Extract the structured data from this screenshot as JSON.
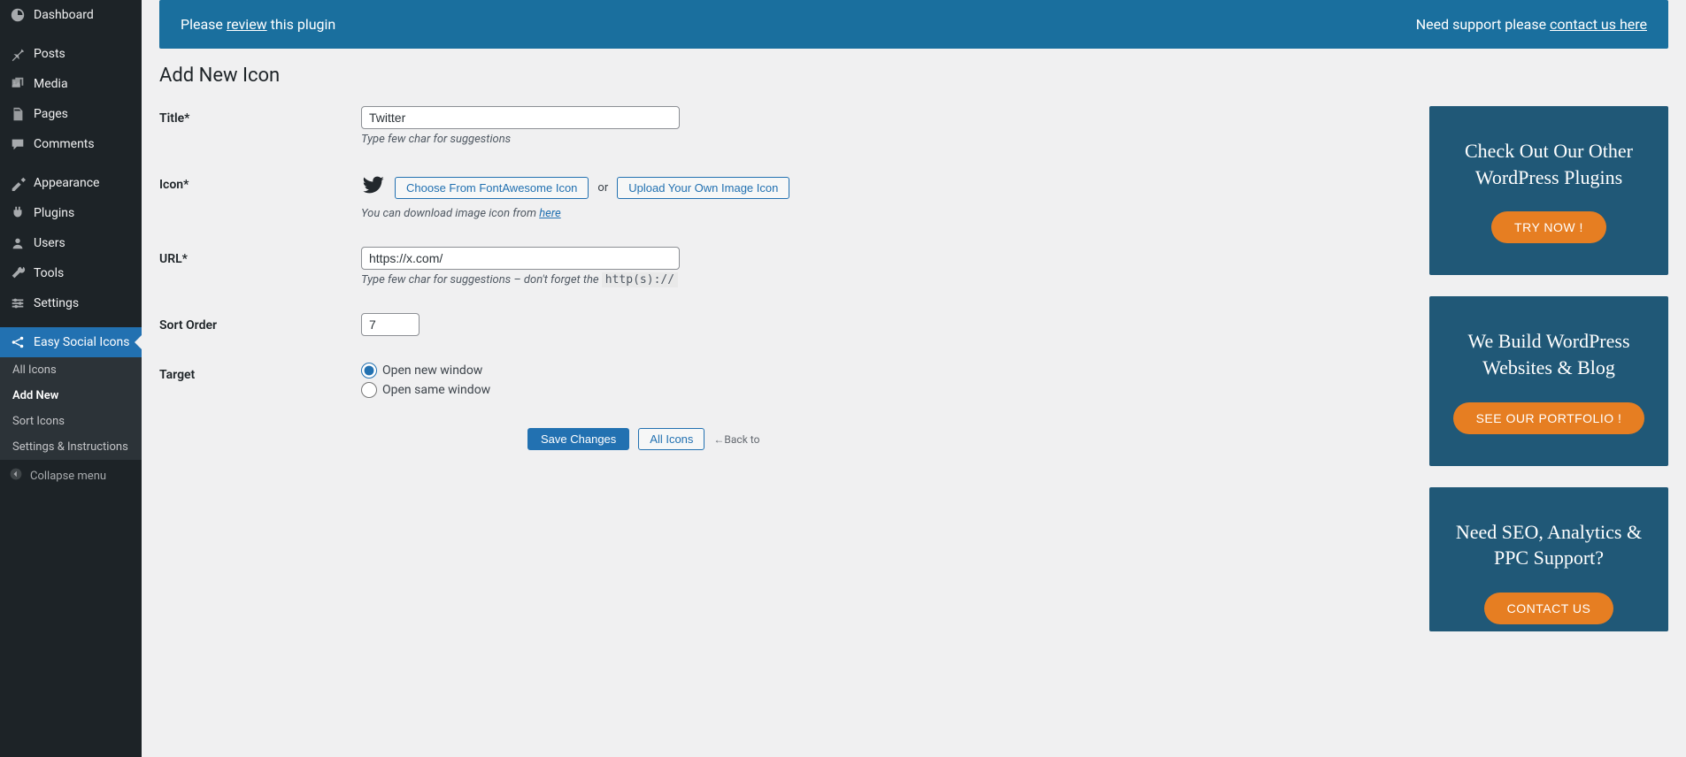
{
  "sidebar": {
    "items": [
      {
        "label": "Dashboard",
        "icon": "dashboard"
      },
      {
        "label": "Posts",
        "icon": "pin"
      },
      {
        "label": "Media",
        "icon": "media"
      },
      {
        "label": "Pages",
        "icon": "pages"
      },
      {
        "label": "Comments",
        "icon": "comments"
      },
      {
        "label": "Appearance",
        "icon": "appearance"
      },
      {
        "label": "Plugins",
        "icon": "plugins"
      },
      {
        "label": "Users",
        "icon": "users"
      },
      {
        "label": "Tools",
        "icon": "tools"
      },
      {
        "label": "Settings",
        "icon": "settings"
      },
      {
        "label": "Easy Social Icons",
        "icon": "share"
      }
    ],
    "submenu": [
      {
        "label": "All Icons"
      },
      {
        "label": "Add New"
      },
      {
        "label": "Sort Icons"
      },
      {
        "label": "Settings & Instructions"
      }
    ],
    "collapse": "Collapse menu"
  },
  "banner": {
    "left_prefix": "Please ",
    "left_link": "review",
    "left_suffix": " this plugin",
    "right_prefix": "Need support please ",
    "right_link": "contact us here"
  },
  "page": {
    "title": "Add New Icon"
  },
  "form": {
    "title": {
      "label": "Title*",
      "value": "Twitter",
      "hint": "Type few char for suggestions"
    },
    "icon": {
      "label": "Icon*",
      "choose_btn": "Choose From FontAwesome Icon",
      "or": "or",
      "upload_btn": "Upload Your Own Image Icon",
      "hint_prefix": "You can download image icon from ",
      "hint_link": "here"
    },
    "url": {
      "label": "URL*",
      "value": "https://x.com/",
      "hint_prefix": "Type few char for suggestions – don't forget the ",
      "hint_code": "http(s)://"
    },
    "sort": {
      "label": "Sort Order",
      "value": "7"
    },
    "target": {
      "label": "Target",
      "opt_new": "Open new window",
      "opt_same": "Open same window",
      "selected": "new"
    },
    "actions": {
      "save": "Save Changes",
      "all": "All Icons",
      "back_to": "←Back to"
    }
  },
  "ads": [
    {
      "heading": "Check Out Our Other WordPress Plugins",
      "cta": "TRY NOW !"
    },
    {
      "heading": "We Build WordPress Websites & Blog",
      "cta": "SEE OUR PORTFOLIO !"
    },
    {
      "heading": "Need SEO, Analytics & PPC Support?",
      "cta": "CONTACT US"
    }
  ]
}
